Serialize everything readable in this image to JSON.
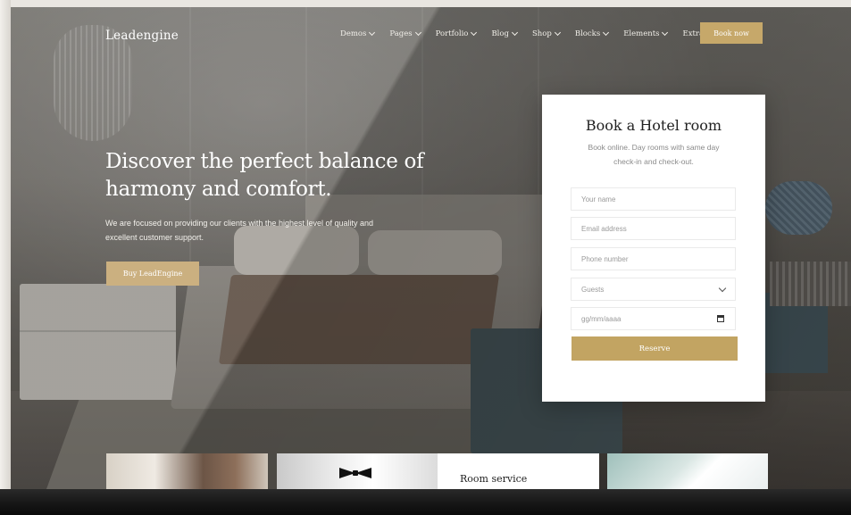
{
  "nav": {
    "logo": "Leadengine",
    "menu": [
      "Demos",
      "Pages",
      "Portfolio",
      "Blog",
      "Shop",
      "Blocks",
      "Elements",
      "Extra"
    ],
    "book_now": "Book now"
  },
  "hero": {
    "title_line1": "Discover the perfect balance of",
    "title_line2": "harmony and comfort.",
    "subtitle_line1": "We are focused on providing our clients with the highest level of quality and",
    "subtitle_line2": "excellent customer support.",
    "button": "Buy LeadEngine"
  },
  "booking": {
    "title": "Book a Hotel room",
    "subtitle_line1": "Book online. Day rooms with same day",
    "subtitle_line2": "check-in and check-out.",
    "name_placeholder": "Your name",
    "email_placeholder": "Email address",
    "phone_placeholder": "Phone number",
    "guests_label": "Guests",
    "date_placeholder": "gg/mm/aaaa",
    "reserve": "Reserve"
  },
  "tiles": {
    "room_service": "Room service"
  },
  "colors": {
    "accent_gold": "#c2a462",
    "white": "#ffffff"
  }
}
